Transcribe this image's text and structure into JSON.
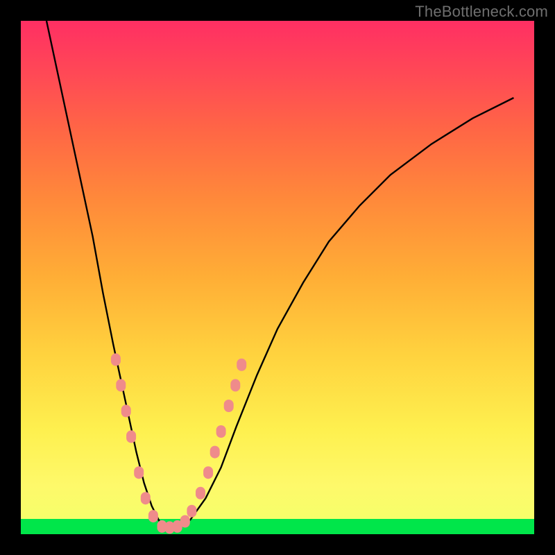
{
  "watermark": "TheBottleneck.com",
  "colors": {
    "frame": "#000000",
    "curve": "#000000",
    "marker": "#ef8b8b",
    "green": "#00e64a"
  },
  "chart_data": {
    "type": "line",
    "title": "",
    "xlabel": "",
    "ylabel": "",
    "xlim": [
      0,
      100
    ],
    "ylim": [
      0,
      100
    ],
    "series": [
      {
        "name": "curve",
        "x": [
          5,
          8,
          11,
          14,
          16,
          18,
          19.5,
          21,
          22.5,
          24,
          25.5,
          27,
          28.5,
          30,
          33,
          36,
          39,
          42,
          46,
          50,
          55,
          60,
          66,
          72,
          80,
          88,
          96
        ],
        "y": [
          100,
          86,
          72,
          58,
          47,
          37,
          30,
          23,
          16,
          10,
          5.5,
          2.5,
          1.2,
          1.2,
          2.8,
          7,
          13,
          21,
          31,
          40,
          49,
          57,
          64,
          70,
          76,
          81,
          85
        ]
      }
    ],
    "markers": [
      {
        "x": 18.5,
        "y": 34
      },
      {
        "x": 19.5,
        "y": 29
      },
      {
        "x": 20.5,
        "y": 24
      },
      {
        "x": 21.5,
        "y": 19
      },
      {
        "x": 23.0,
        "y": 12
      },
      {
        "x": 24.3,
        "y": 7
      },
      {
        "x": 25.8,
        "y": 3.5
      },
      {
        "x": 27.5,
        "y": 1.5
      },
      {
        "x": 29.0,
        "y": 1.3
      },
      {
        "x": 30.5,
        "y": 1.5
      },
      {
        "x": 32.0,
        "y": 2.5
      },
      {
        "x": 33.3,
        "y": 4.5
      },
      {
        "x": 35.0,
        "y": 8
      },
      {
        "x": 36.5,
        "y": 12
      },
      {
        "x": 37.8,
        "y": 16
      },
      {
        "x": 39.0,
        "y": 20
      },
      {
        "x": 40.5,
        "y": 25
      },
      {
        "x": 41.8,
        "y": 29
      },
      {
        "x": 43.0,
        "y": 33
      }
    ]
  }
}
